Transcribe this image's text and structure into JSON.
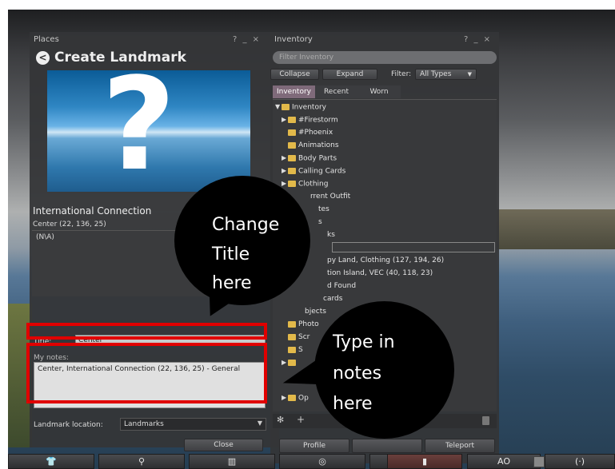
{
  "places": {
    "window_title": "Places",
    "window_controls": "? _ ×",
    "heading": "Create Landmark",
    "location_name": "International Connection",
    "coords": "Center (22, 136, 25)",
    "region": "(N\\A)",
    "title_label": "Title:",
    "title_value": "Center",
    "notes_label": "My notes:",
    "notes_value": "Center, International Connection (22, 136, 25) - General",
    "landmark_location_label": "Landmark location:",
    "landmark_location_value": "Landmarks",
    "close_label": "Close"
  },
  "inventory": {
    "window_title": "Inventory",
    "window_controls": "? _ ×",
    "filter_placeholder": "Filter Inventory",
    "collapse_label": "Collapse",
    "expand_label": "Expand",
    "filter_label": "Filter:",
    "filter_value": "All Types",
    "tabs": [
      "Inventory",
      "Recent",
      "Worn"
    ],
    "rows": [
      {
        "label": "Inventory"
      },
      {
        "label": "#Firestorm"
      },
      {
        "label": "#Phoenix"
      },
      {
        "label": "Animations"
      },
      {
        "label": "Body Parts"
      },
      {
        "label": "Calling Cards"
      },
      {
        "label": "Clothing"
      },
      {
        "label": "rrent Outfit"
      },
      {
        "label": "tes"
      },
      {
        "label": "s"
      },
      {
        "label": "ks"
      },
      {
        "label": "py Land, Clothing (127, 194, 26)"
      },
      {
        "label": "tion Island, VEC (40, 118, 23)"
      },
      {
        "label": "d Found"
      },
      {
        "label": "cards"
      },
      {
        "label": "bjects"
      },
      {
        "label": "Photo"
      },
      {
        "label": "Scr"
      },
      {
        "label": "S"
      },
      {
        "label": "Op"
      }
    ],
    "profile_label": "Profile",
    "teleport_label": "Teleport"
  },
  "callouts": {
    "title_callout": [
      "Change",
      "Title",
      "here"
    ],
    "notes_callout": [
      "Type in",
      "notes",
      "here"
    ]
  },
  "toolbar": {
    "ao_label": "AO"
  },
  "colors": {
    "callout_bg": "#000000",
    "highlight_border": "#e00000",
    "folder": "#e2b94a",
    "selected_tab": "#7f6a7a"
  }
}
